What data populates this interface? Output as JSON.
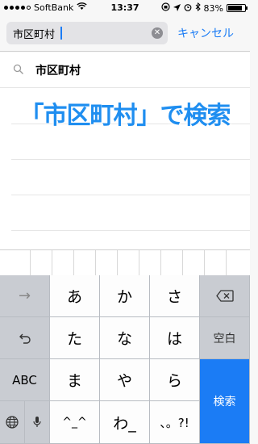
{
  "status_bar": {
    "carrier": "SoftBank",
    "time": "13:37",
    "battery": "83%",
    "icons": [
      "signal-icon",
      "wifi-icon",
      "lock-rotation-icon",
      "location-icon",
      "alarm-icon",
      "bluetooth-icon",
      "battery-icon"
    ]
  },
  "search": {
    "value": "市区町村",
    "cancel_label": "キャンセル"
  },
  "suggestions": [
    {
      "label": "市区町村"
    }
  ],
  "callout": "「市区町村」で検索",
  "keyboard": {
    "row1": [
      "→",
      "あ",
      "か",
      "さ",
      "⌫"
    ],
    "row2": [
      "↺",
      "た",
      "な",
      "は",
      "空白"
    ],
    "row3": [
      "ABC",
      "ま",
      "や",
      "ら"
    ],
    "row4": [
      "🌐",
      "🎤",
      "^_^",
      "わ_",
      "、。?!"
    ],
    "search_label": "検索"
  },
  "colors": {
    "accent": "#1b7cf5",
    "callout": "#1f8ef0"
  }
}
